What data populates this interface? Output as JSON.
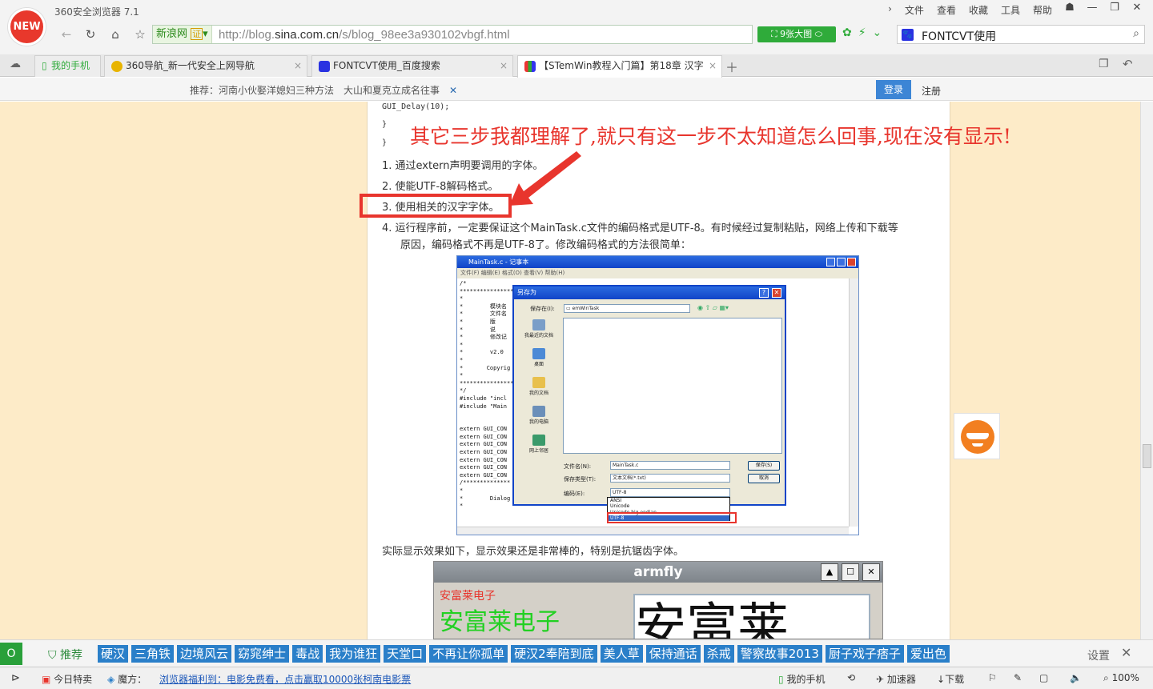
{
  "app": {
    "title": "360安全浏览器 7.1",
    "logo_text": "NEW"
  },
  "menu": [
    "文件",
    "查看",
    "收藏",
    "工具",
    "帮助"
  ],
  "nav": {
    "site_name": "新浪网",
    "cert_label": "证",
    "url_prefix": "http://blog.",
    "url_domain": "sina.com.cn",
    "url_path": "/s/blog_98ee3a930102vbgf.html",
    "image_button": "9张大图",
    "search_query": "FONTCVT使用"
  },
  "tabs": [
    {
      "label": "我的手机"
    },
    {
      "label": "360导航_新一代安全上网导航"
    },
    {
      "label": "FONTCVT使用_百度搜索"
    },
    {
      "label": "【STemWin教程入门篇】第18章 汉字"
    }
  ],
  "infobar": {
    "recommend_label": "推荐：",
    "rec1": "河南小伙娶洋媳妇三种方法",
    "rec2": "大山和夏克立成名往事",
    "login": "登录",
    "register": "注册"
  },
  "article": {
    "code1": "GUI_Delay(10);",
    "code2": "}",
    "code3": "}",
    "annotation": "其它三步我都理解了,就只有这一步不太知道怎么回事,现在没有显示!",
    "step1": "1. 通过extern声明要调用的字体。",
    "step2": "2. 使能UTF-8解码格式。",
    "step3": "3. 使用相关的汉字字体。",
    "step4a": "4. 运行程序前，一定要保证这个MainTask.c文件的编码格式是UTF-8。有时候经过复制粘贴，网络上传和下载等",
    "step4b": "原因，编码格式不再是UTF-8了。修改编码格式的方法很简单：",
    "result": "实际显示效果如下，显示效果还是非常棒的，特别是抗锯齿字体。"
  },
  "notepad": {
    "title": "MainTask.c - 记事本",
    "menu": "文件(F)   编辑(E)   格式(O)   查看(V)   帮助(H)",
    "text": "/*\n************************************************************************************************\n*\n*        模块名\n*        文件名\n*        版\n*        说\n*        修改记\n*\n*        v2.0\n*\n*       Copyrig\n*\n************************************************************************************************\n*/\n#include \"incl\n#include \"Main\n\n\nextern GUI_CON\nextern GUI_CON\nextern GUI_CON\nextern GUI_CON\nextern GUI_CON\nextern GUI_CON\nextern GUI_CON\n/**************\n*\n*        Dialog resource\n*"
  },
  "saveas": {
    "title": "另存为",
    "save_in_label": "保存在(I):",
    "save_in_value": "emWinTask",
    "sidebar": [
      "我最近的文档",
      "桌面",
      "我的文档",
      "我的电脑",
      "网上邻居"
    ],
    "filename_label": "文件名(N):",
    "filename_value": "MainTask.c",
    "type_label": "保存类型(T):",
    "type_value": "文本文档(*.txt)",
    "encoding_label": "编码(E):",
    "encoding_value": "UTF-8",
    "save_button": "保存(S)",
    "cancel_button": "取消",
    "encoding_options": [
      "ANSI",
      "Unicode",
      "Unicode big endian",
      "UTF-8"
    ]
  },
  "demo": {
    "title": "armfly",
    "small_text": "安富莱电子",
    "big_text": "安富莱电子",
    "huge_text": "安富莱"
  },
  "hotbar": {
    "recommend": "推荐",
    "tags": [
      "硬汉",
      "三角铁",
      "边境风云",
      "窈窕绅士",
      "毒战",
      "我为谁狂",
      "天堂口",
      "不再让你孤单",
      "硬汉2奉陪到底",
      "美人草",
      "保持通话",
      "杀戒",
      "警察故事2013",
      "厨子戏子痞子",
      "爱出色"
    ],
    "settings": "设置"
  },
  "status": {
    "today": "今日特卖",
    "cube": "魔方：",
    "promo": "浏览器福利到：电影免费看，点击赢取10000张柯南电影票",
    "phone": "我的手机",
    "accelerator": "加速器",
    "download": "下载",
    "zoom": "100%"
  },
  "colors": {
    "accent_green": "#2fab3a",
    "annotation_red": "#e8352d",
    "page_bg": "#fdebc8",
    "tag_blue": "#2a7fc9"
  }
}
